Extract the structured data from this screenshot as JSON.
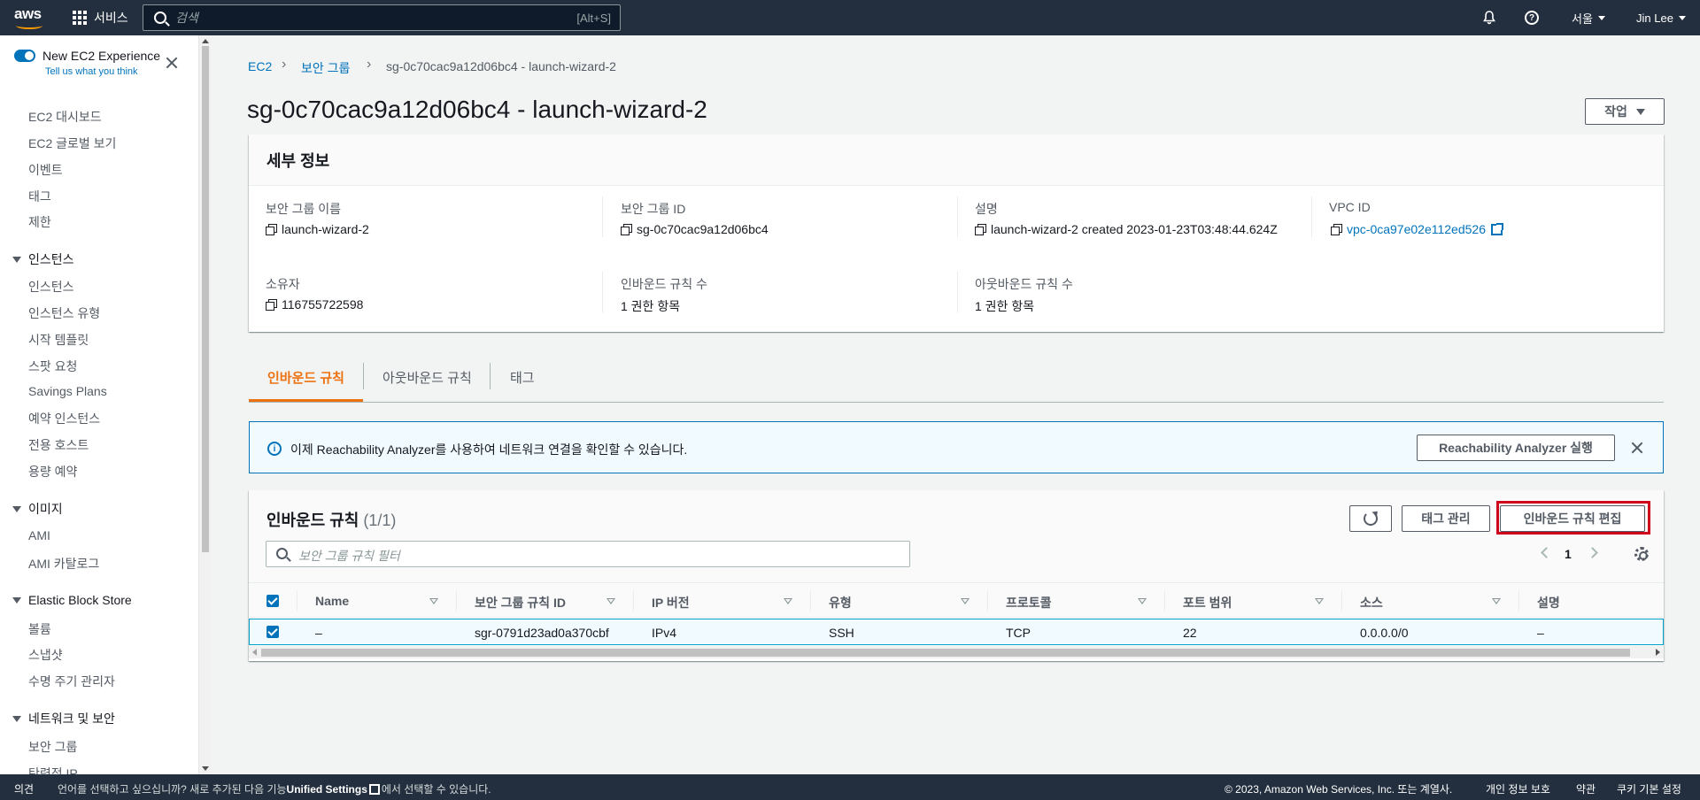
{
  "topnav": {
    "logo": "aws",
    "services_label": "서비스",
    "search_placeholder": "검색",
    "search_shortcut": "[Alt+S]",
    "region": "서울",
    "user": "Jin Lee"
  },
  "sidebar": {
    "new_experience": "New EC2 Experience",
    "tell_us": "Tell us what you think",
    "items_top": [
      "EC2 대시보드",
      "EC2 글로벌 보기",
      "이벤트",
      "태그",
      "제한"
    ],
    "sections": [
      {
        "title": "인스턴스",
        "items": [
          "인스턴스",
          "인스턴스 유형",
          "시작 템플릿",
          "스팟 요청",
          "Savings Plans",
          "예약 인스턴스",
          "전용 호스트",
          "용량 예약"
        ]
      },
      {
        "title": "이미지",
        "items": [
          "AMI",
          "AMI 카탈로그"
        ]
      },
      {
        "title": "Elastic Block Store",
        "items": [
          "볼륨",
          "스냅샷",
          "수명 주기 관리자"
        ]
      },
      {
        "title": "네트워크 및 보안",
        "items": [
          "보안 그룹",
          "탄력적 IP"
        ]
      }
    ]
  },
  "breadcrumb": {
    "items": [
      "EC2",
      "보안 그룹"
    ],
    "current": "sg-0c70cac9a12d06bc4 - launch-wizard-2"
  },
  "page": {
    "title": "sg-0c70cac9a12d06bc4 - launch-wizard-2",
    "action_button": "작업"
  },
  "details": {
    "title": "세부 정보",
    "fields": {
      "name_label": "보안 그룹 이름",
      "name_value": "launch-wizard-2",
      "id_label": "보안 그룹 ID",
      "id_value": "sg-0c70cac9a12d06bc4",
      "desc_label": "설명",
      "desc_value": "launch-wizard-2 created 2023-01-23T03:48:44.624Z",
      "vpc_label": "VPC ID",
      "vpc_value": "vpc-0ca97e02e112ed526",
      "owner_label": "소유자",
      "owner_value": "116755722598",
      "inbound_count_label": "인바운드 규칙 수",
      "inbound_count_value": "1 권한 항목",
      "outbound_count_label": "아웃바운드 규칙 수",
      "outbound_count_value": "1 권한 항목"
    }
  },
  "tabs": [
    "인바운드 규칙",
    "아웃바운드 규칙",
    "태그"
  ],
  "alert": {
    "text": "이제 Reachability Analyzer를 사용하여 네트워크 연결을 확인할 수 있습니다.",
    "button": "Reachability Analyzer 실행"
  },
  "rules_table": {
    "title": "인바운드 규칙",
    "count": "(1/1)",
    "manage_tags": "태그 관리",
    "edit_button": "인바운드 규칙 편집",
    "filter_placeholder": "보안 그룹 규칙 필터",
    "page": "1",
    "columns": [
      "Name",
      "보안 그룹 규칙 ID",
      "IP 버전",
      "유형",
      "프로토콜",
      "포트 범위",
      "소스",
      "설명"
    ],
    "rows": [
      [
        "–",
        "sgr-0791d23ad0a370cbf",
        "IPv4",
        "SSH",
        "TCP",
        "22",
        "0.0.0.0/0",
        "–"
      ]
    ]
  },
  "footer": {
    "feedback": "의견",
    "lang_prefix": "언어를 선택하고 싶으십니까? 새로 추가된 다음 기능",
    "lang_link": "Unified Settings",
    "lang_suffix": "에서 선택할 수 있습니다.",
    "copyright": "© 2023, Amazon Web Services, Inc. 또는 계열사.",
    "privacy": "개인 정보 보호",
    "terms": "약관",
    "cookies": "쿠키 기본 설정"
  }
}
